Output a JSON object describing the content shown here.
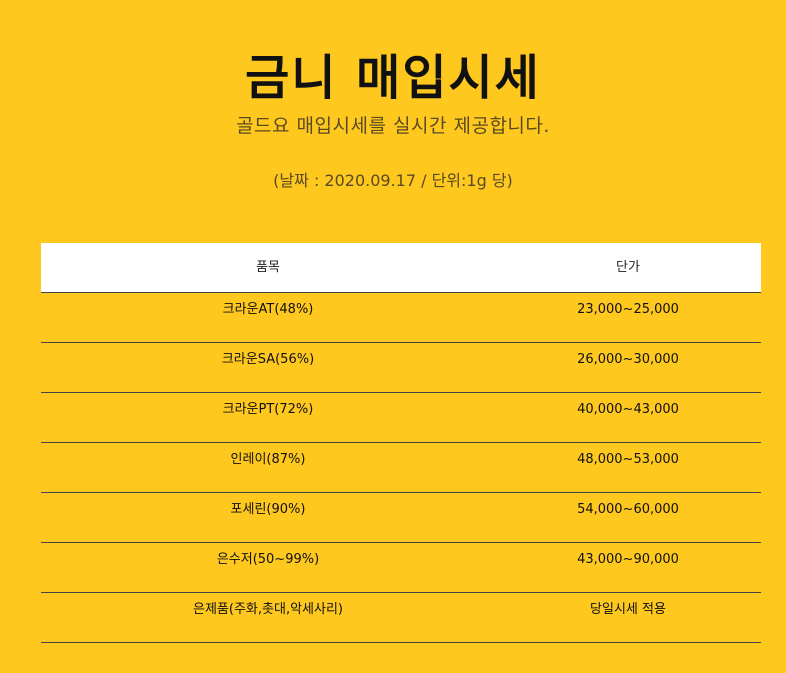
{
  "header": {
    "title": "금니 매입시세",
    "subtitle": "골드요 매입시세를 실시간 제공합니다.",
    "meta": "(날짜 : 2020.09.17 / 단위:1g 당)"
  },
  "table": {
    "columns": [
      "품목",
      "단가"
    ],
    "rows": [
      {
        "item": "크라운AT(48%)",
        "price": "23,000~25,000"
      },
      {
        "item": "크라운SA(56%)",
        "price": "26,000~30,000"
      },
      {
        "item": "크라운PT(72%)",
        "price": "40,000~43,000"
      },
      {
        "item": "인레이(87%)",
        "price": "48,000~53,000"
      },
      {
        "item": "포세린(90%)",
        "price": "54,000~60,000"
      },
      {
        "item": "은수저(50~99%)",
        "price": "43,000~90,000"
      },
      {
        "item": "은제품(주화,촛대,악세사리)",
        "price": "당일시세 적용"
      }
    ]
  },
  "colors": {
    "background": "#FFC81E",
    "header_row": "#FFFFFF",
    "text": "#111111"
  }
}
